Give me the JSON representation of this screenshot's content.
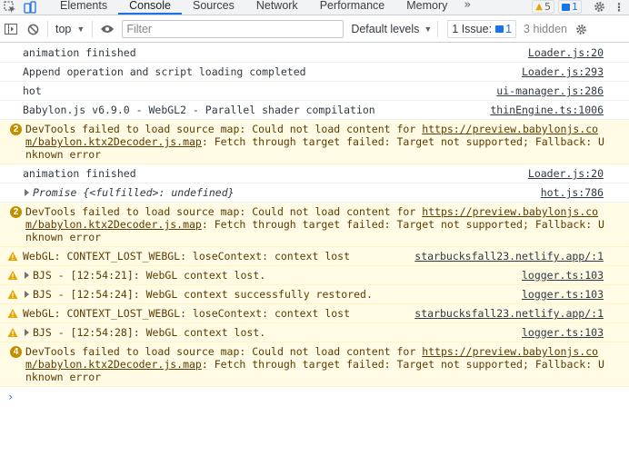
{
  "tabs": {
    "items": [
      "Elements",
      "Console",
      "Sources",
      "Network",
      "Performance",
      "Memory"
    ],
    "more": "»",
    "warnings_count": "5",
    "messages_count": "1"
  },
  "toolbar": {
    "context": "top",
    "filter_placeholder": "Filter",
    "levels": "Default levels",
    "issues_label": "1 Issue:",
    "issues_count": "1",
    "hidden": "3 hidden"
  },
  "messages": [
    {
      "text": "animation finished",
      "source": "Loader.js:20"
    },
    {
      "text": "Append operation and script loading completed",
      "source": "Loader.js:293"
    },
    {
      "text": "hot",
      "source": "ui-manager.js:286"
    },
    {
      "text": "Babylon.js v6.9.0 - WebGL2 - Parallel shader compilation",
      "source": "thinEngine.ts:1006"
    },
    {
      "count": "2",
      "pre": "DevTools failed to load source map: Could not load content for ",
      "link": "https://preview.babylonjs.com/babylon.ktx2Decoder.js.map",
      "post": ": Fetch through target failed: Target not supported; Fallback: Unknown error"
    },
    {
      "text": "animation finished",
      "source": "Loader.js:20"
    },
    {
      "text": "Promise {<fulfilled>: undefined}",
      "source": "hot.js:786"
    },
    {
      "count": "2",
      "pre": "DevTools failed to load source map: Could not load content for ",
      "link": "https://preview.babylonjs.com/babylon.ktx2Decoder.js.map",
      "post": ": Fetch through target failed: Target not supported; Fallback: Unknown error"
    },
    {
      "text": "WebGL: CONTEXT_LOST_WEBGL: loseContext: context lost",
      "source": "starbucksfall23.netlify.app/:1"
    },
    {
      "text": "BJS - [12:54:21]: WebGL context lost.",
      "source": "logger.ts:103"
    },
    {
      "text": "BJS - [12:54:24]: WebGL context successfully restored.",
      "source": "logger.ts:103"
    },
    {
      "text": "WebGL: CONTEXT_LOST_WEBGL: loseContext: context lost",
      "source": "starbucksfall23.netlify.app/:1"
    },
    {
      "text": "BJS - [12:54:28]: WebGL context lost.",
      "source": "logger.ts:103"
    },
    {
      "count": "4",
      "pre": "DevTools failed to load source map: Could not load content for ",
      "link": "https://preview.babylonjs.com/babylon.ktx2Decoder.js.map",
      "post": ": Fetch through target failed: Target not supported; Fallback: Unknown error"
    }
  ],
  "prompt": "›",
  "colors": {
    "accent": "#1a73e8",
    "warning_bg": "#fffbe5",
    "warning_text": "#5c3c00"
  }
}
